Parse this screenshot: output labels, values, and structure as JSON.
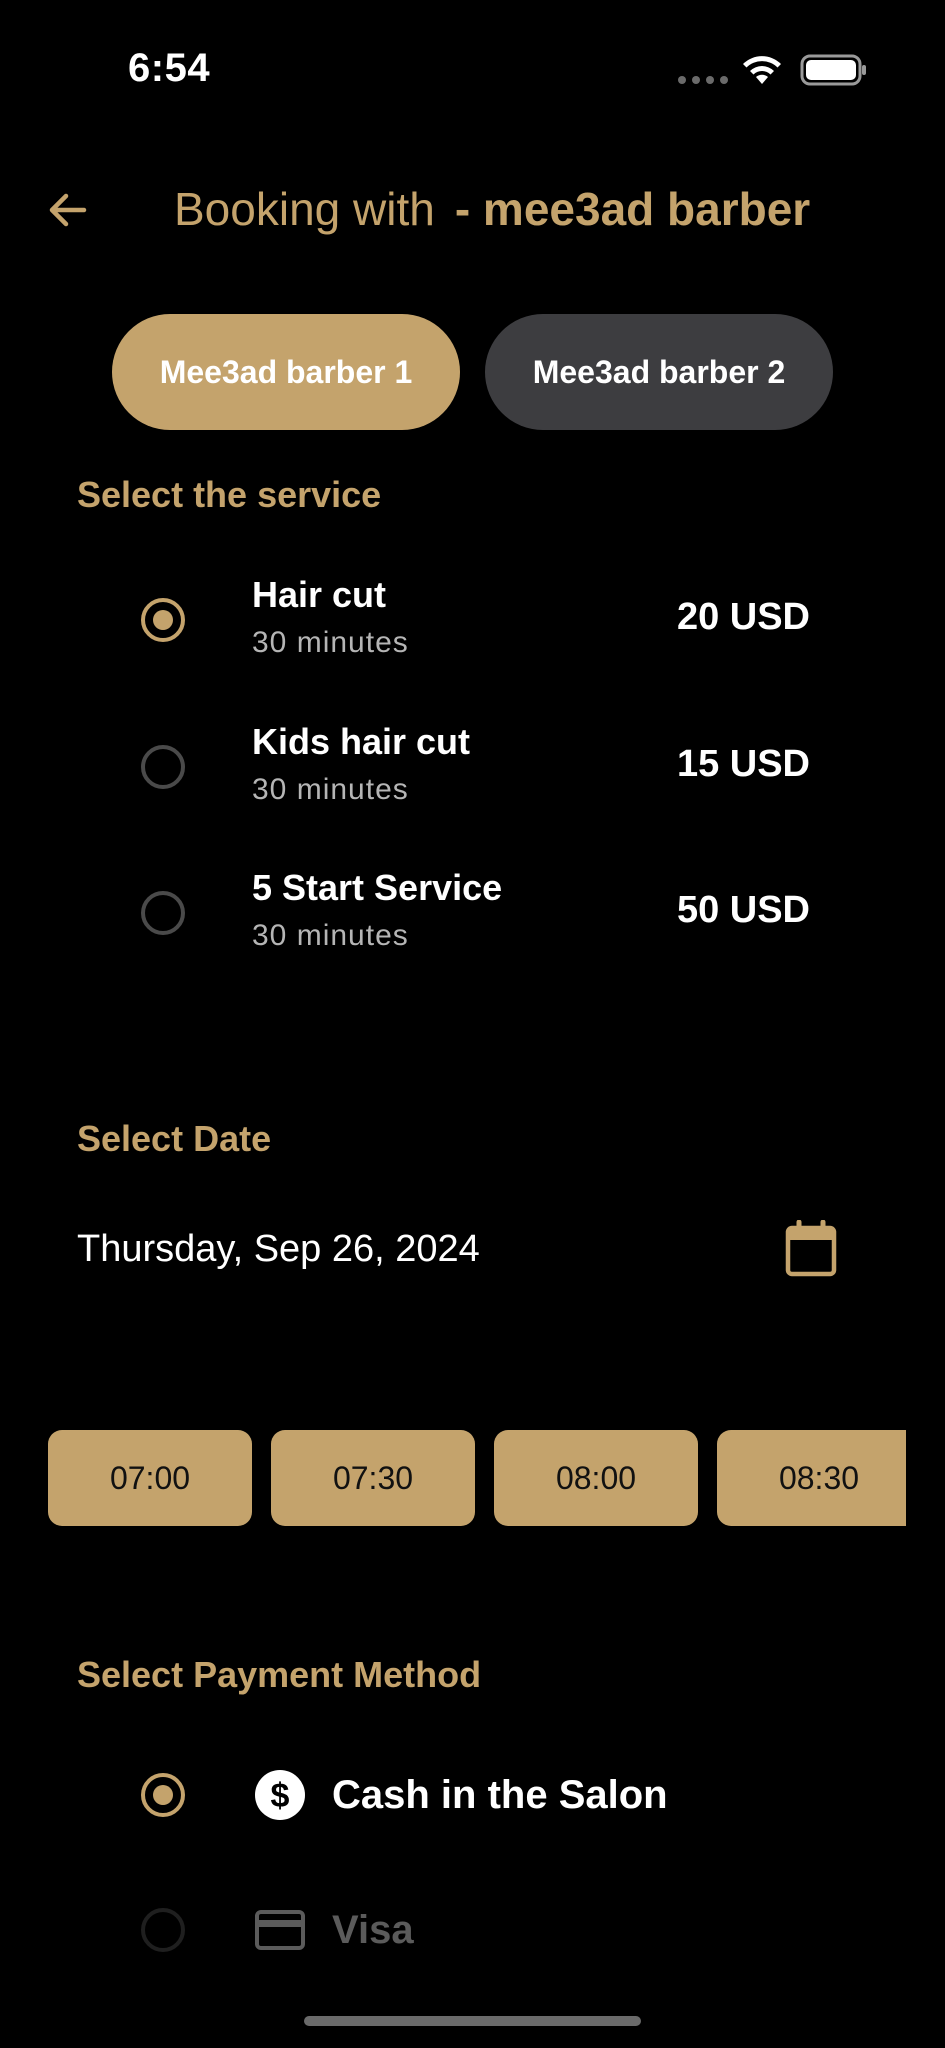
{
  "status_bar": {
    "time": "6:54"
  },
  "header": {
    "title_prefix": "Booking with",
    "title_name": "- mee3ad barber"
  },
  "barber_tabs": [
    {
      "label": "Mee3ad barber 1",
      "selected": true
    },
    {
      "label": "Mee3ad barber 2",
      "selected": false
    }
  ],
  "service_section": {
    "title": "Select the service",
    "services": [
      {
        "name": "Hair cut",
        "duration": "30 minutes",
        "price": "20 USD",
        "selected": true
      },
      {
        "name": "Kids hair cut",
        "duration": "30 minutes",
        "price": "15 USD",
        "selected": false
      },
      {
        "name": "5 Start Service",
        "duration": "30 minutes",
        "price": "50 USD",
        "selected": false
      }
    ]
  },
  "date_section": {
    "title": "Select Date",
    "value": "Thursday, Sep 26, 2024"
  },
  "time_slots": [
    "07:00",
    "07:30",
    "08:00",
    "08:30"
  ],
  "payment_section": {
    "title": "Select Payment Method",
    "methods": [
      {
        "label": "Cash in the Salon",
        "icon": "dollar-icon",
        "selected": true
      },
      {
        "label": "Visa",
        "icon": "credit-card-icon",
        "selected": false
      }
    ]
  },
  "colors": {
    "accent": "#c4a36c",
    "background": "#000000",
    "tab_inactive": "#3d3d40"
  }
}
